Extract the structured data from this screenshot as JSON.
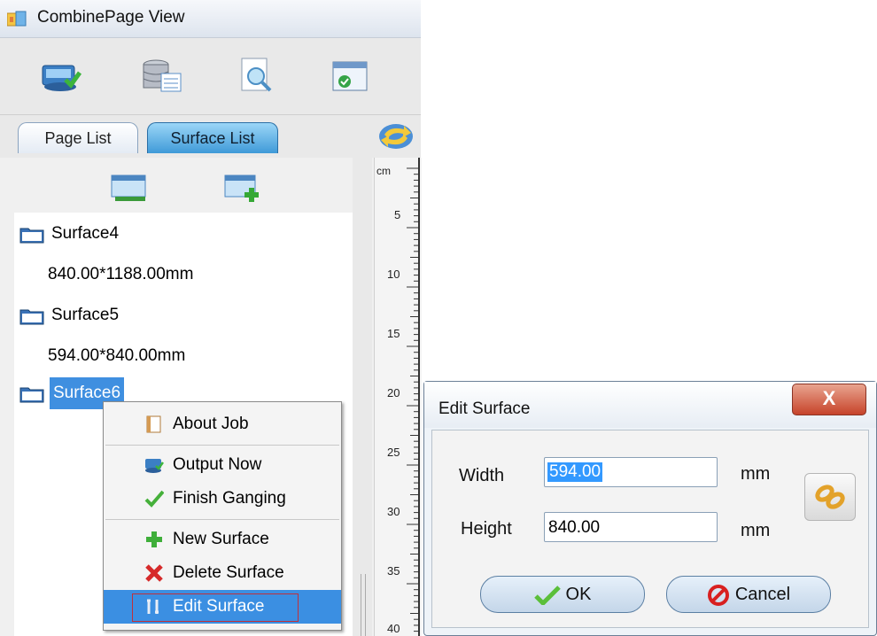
{
  "window": {
    "title": "CombinePage View"
  },
  "toolbar": {
    "buttons": [
      {
        "name": "output-icon"
      },
      {
        "name": "database-icon"
      },
      {
        "name": "preview-icon"
      },
      {
        "name": "window-check-icon"
      }
    ]
  },
  "tabs": [
    {
      "label": "Page List",
      "active": false
    },
    {
      "label": "Surface List",
      "active": true
    }
  ],
  "surface_list": {
    "items": [
      {
        "name": "Surface4",
        "size": "840.00*1188.00mm"
      },
      {
        "name": "Surface5",
        "size": "594.00*840.00mm"
      },
      {
        "name": "Surface6",
        "selected": true
      }
    ]
  },
  "ruler": {
    "unit": "cm",
    "labels": [
      "5",
      "10",
      "15",
      "20",
      "25",
      "30",
      "35",
      "40"
    ]
  },
  "context_menu": {
    "items": [
      {
        "label": "About Job",
        "icon": "document-icon"
      },
      {
        "label": "Output Now",
        "icon": "output-icon"
      },
      {
        "label": "Finish Ganging",
        "icon": "checkmark-icon"
      },
      {
        "label": "New Surface",
        "icon": "plus-icon"
      },
      {
        "label": "Delete Surface",
        "icon": "delete-x-icon"
      },
      {
        "label": "Edit Surface",
        "icon": "tools-icon",
        "highlighted": true
      }
    ]
  },
  "dialog": {
    "title": "Edit Surface",
    "close_label": "X",
    "width_label": "Width",
    "width_value": "594.00",
    "height_label": "Height",
    "height_value": "840.00",
    "unit": "mm",
    "ok_label": "OK",
    "cancel_label": "Cancel"
  },
  "colors": {
    "selection": "#3f8fe0",
    "close_button": "#c6432a",
    "active_tab": "#3f9ad8"
  }
}
